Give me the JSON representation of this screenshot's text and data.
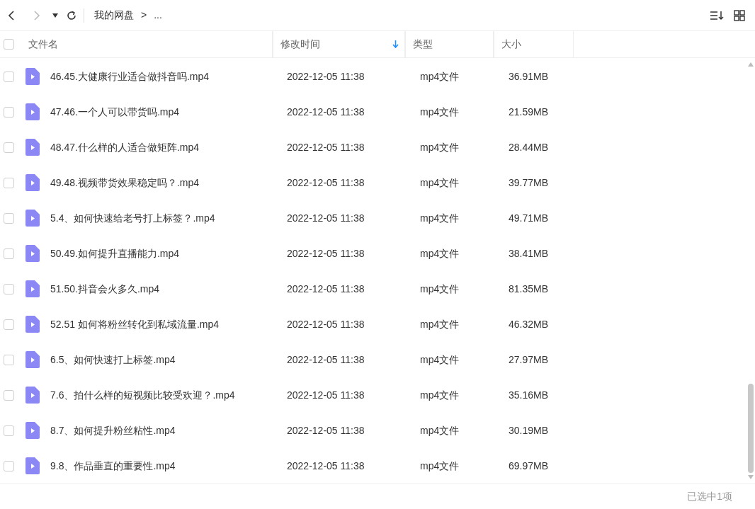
{
  "toolbar": {
    "breadcrumb": [
      {
        "label": "我的网盘"
      },
      {
        "label": ">"
      },
      {
        "label": "..."
      }
    ]
  },
  "table": {
    "columns": [
      {
        "label": "文件名",
        "sorted": false
      },
      {
        "label": "修改时间",
        "sorted": true
      },
      {
        "label": "类型",
        "sorted": false
      },
      {
        "label": "大小",
        "sorted": false
      }
    ],
    "all_checked": false,
    "rows": [
      {
        "name": "46.45.大健康行业适合做抖音吗.mp4",
        "modified": "2022-12-05 11:38",
        "type": "mp4文件",
        "size": "36.91MB",
        "checked": false
      },
      {
        "name": "47.46.一个人可以带货吗.mp4",
        "modified": "2022-12-05 11:38",
        "type": "mp4文件",
        "size": "21.59MB",
        "checked": false
      },
      {
        "name": "48.47.什么样的人适合做矩阵.mp4",
        "modified": "2022-12-05 11:38",
        "type": "mp4文件",
        "size": "28.44MB",
        "checked": false
      },
      {
        "name": "49.48.视频带货效果稳定吗？.mp4",
        "modified": "2022-12-05 11:38",
        "type": "mp4文件",
        "size": "39.77MB",
        "checked": false
      },
      {
        "name": "5.4、如何快速给老号打上标签？.mp4",
        "modified": "2022-12-05 11:38",
        "type": "mp4文件",
        "size": "49.71MB",
        "checked": false
      },
      {
        "name": "50.49.如何提升直播能力.mp4",
        "modified": "2022-12-05 11:38",
        "type": "mp4文件",
        "size": "38.41MB",
        "checked": false
      },
      {
        "name": "51.50.抖音会火多久.mp4",
        "modified": "2022-12-05 11:38",
        "type": "mp4文件",
        "size": "81.35MB",
        "checked": false
      },
      {
        "name": "52.51 如何将粉丝转化到私域流量.mp4",
        "modified": "2022-12-05 11:38",
        "type": "mp4文件",
        "size": "46.32MB",
        "checked": false
      },
      {
        "name": "6.5、如何快速打上标签.mp4",
        "modified": "2022-12-05 11:38",
        "type": "mp4文件",
        "size": "27.97MB",
        "checked": false
      },
      {
        "name": "7.6、拍什么样的短视频比较受欢迎？.mp4",
        "modified": "2022-12-05 11:38",
        "type": "mp4文件",
        "size": "35.16MB",
        "checked": false
      },
      {
        "name": "8.7、如何提升粉丝粘性.mp4",
        "modified": "2022-12-05 11:38",
        "type": "mp4文件",
        "size": "30.19MB",
        "checked": false
      },
      {
        "name": "9.8、作品垂直的重要性.mp4",
        "modified": "2022-12-05 11:38",
        "type": "mp4文件",
        "size": "69.97MB",
        "checked": false
      }
    ]
  },
  "status_bar": {
    "text": "已选中1项"
  }
}
